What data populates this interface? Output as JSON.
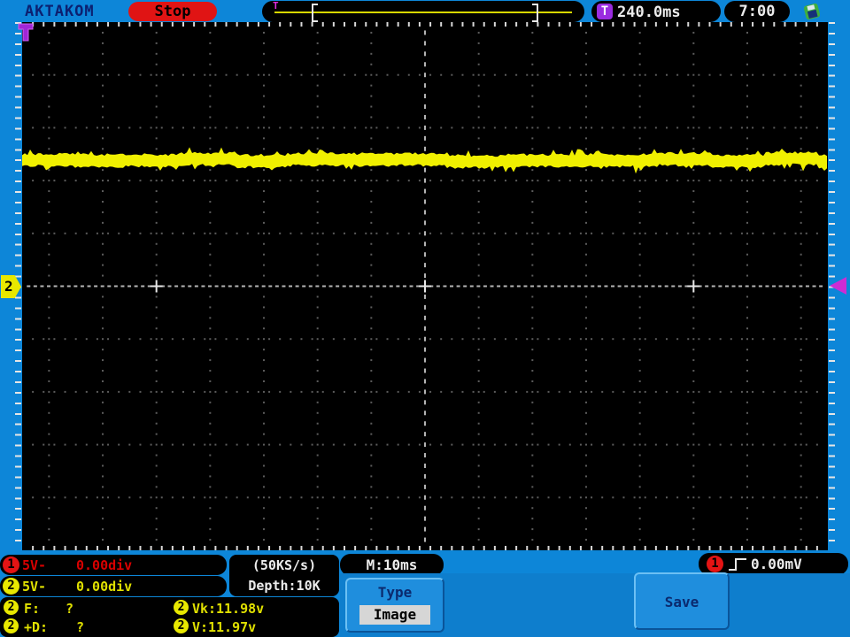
{
  "top_bar": {
    "brand": "AKTAKOM",
    "run_state": "Stop",
    "trigger_icon": "T",
    "trigger_position": "240.0ms",
    "clock": "7:00"
  },
  "channels": [
    {
      "id": "1",
      "scale": "5V-",
      "offset": "0.00div",
      "color": "#e41414"
    },
    {
      "id": "2",
      "scale": "5V-",
      "offset": "0.00div",
      "color": "#e8e800"
    }
  ],
  "acquisition": {
    "sample_rate": "(50KS/s)",
    "depth": "Depth:10K"
  },
  "timebase": {
    "label": "M:10ms"
  },
  "trigger": {
    "source": "1",
    "type": "rising-edge",
    "level": "0.00mV"
  },
  "measurements": [
    {
      "channel": "2",
      "label": "F:",
      "value": "?"
    },
    {
      "channel": "2",
      "label": "Vk:",
      "value": "11.98v"
    },
    {
      "channel": "2",
      "label": "+D:",
      "value": "?"
    },
    {
      "channel": "2",
      "label": "V:",
      "value": "11.97v"
    }
  ],
  "menu": {
    "type_label": "Type",
    "type_value": "Image",
    "save_label": "Save"
  },
  "colors": {
    "frame_blue": "#0d86d8",
    "trace_yellow": "#f0f000",
    "ch1_red": "#e41414",
    "ch2_yellow": "#e8e800",
    "trigger_magenta": "#cc2cd4",
    "stop_red": "#e01414"
  },
  "chart_data": {
    "type": "line",
    "title": "Oscilloscope display - CH2 flat DC trace with noise",
    "x_axis": {
      "time_per_div": "10ms",
      "divisions": 15,
      "total_time_ms": 150
    },
    "y_axis": {
      "volts_per_div": 5,
      "divisions": 10
    },
    "grid": "dotted, center crosshair, + marks at ±5 divisions",
    "series": [
      {
        "name": "CH2",
        "color": "#f0f000",
        "description": "flat noisy DC level spanning full width",
        "mean_level_V": 11.97,
        "level_divs_above_center": 2.39,
        "noise_band_thickness_divs": 0.28,
        "zero_level_div": 0
      }
    ],
    "markers": {
      "ch2_zero_marker_left": true,
      "trigger_level_marker_right": true,
      "trigger_position_marker_top_left": true
    }
  }
}
